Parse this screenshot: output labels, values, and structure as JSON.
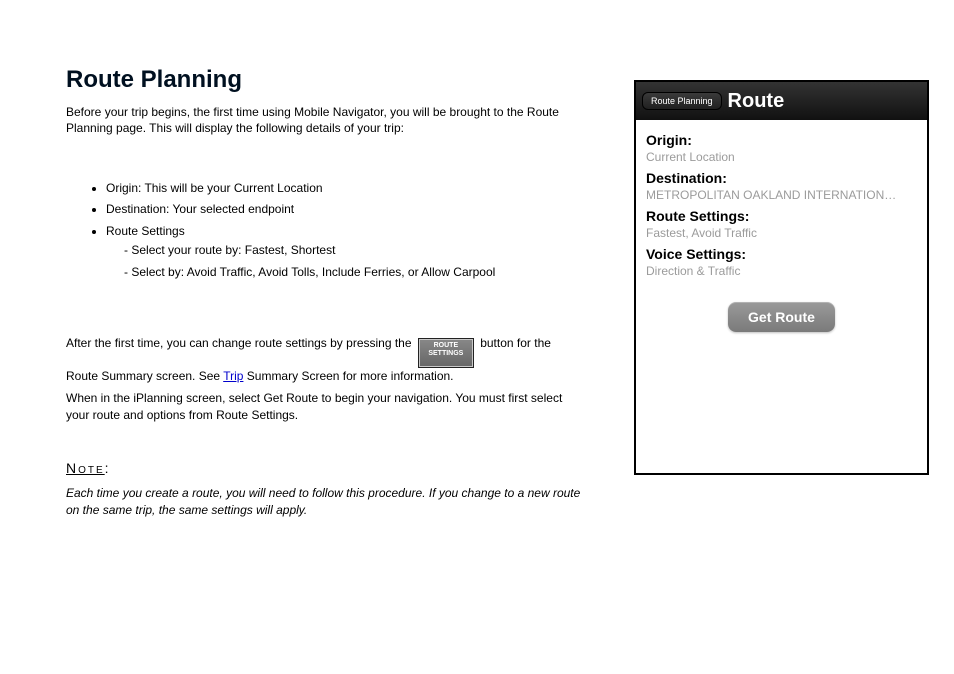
{
  "doc": {
    "heading": "Route Planning",
    "intro": "Before your trip begins, the first time using Mobile Navigator, you will be brought to the Route Planning page. This will display the following details of your trip:",
    "bullets": [
      {
        "text": "Origin: This will be your Current Location"
      },
      {
        "text": "Destination: Your selected endpoint"
      },
      {
        "text": "Route Settings",
        "sub": [
          "Select your route by: Fastest, Shortest",
          "Select by: Avoid Traffic, Avoid Tolls, Include Ferries, or Allow Carpool"
        ]
      }
    ],
    "after_pre": "After the first time, you can change route settings by pressing the ",
    "icon_line1": "ROUTE",
    "icon_line2": "SETTINGS",
    "after_mid": " button for the Route Summary screen. See ",
    "link_text": "Trip",
    "after_post": " Summary Screen for more information.",
    "iplanning": "When in the iPlanning screen, select Get Route to begin your navigation. You must first select your route and options from Route Settings.",
    "note_label_underline": "Note",
    "note_label_tail": ":",
    "note_body": "Each time you create a route, you will need to follow this procedure. If you change to a new route on the same trip, the same settings will apply."
  },
  "phone": {
    "back_button": "Route Planning",
    "title": "Route",
    "rows": {
      "origin_label": "Origin:",
      "origin_value": "Current Location",
      "dest_label": "Destination:",
      "dest_value": "METROPOLITAN OAKLAND INTERNATION…",
      "route_label": "Route Settings:",
      "route_value": "Fastest, Avoid Traffic",
      "voice_label": "Voice Settings:",
      "voice_value": "Direction & Traffic"
    },
    "get_route": "Get Route"
  }
}
